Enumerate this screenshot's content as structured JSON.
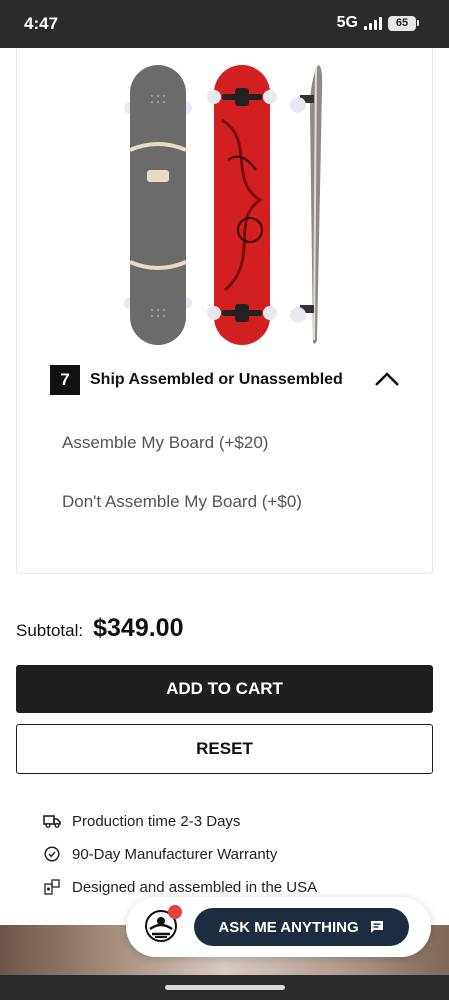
{
  "status_bar": {
    "time": "4:47",
    "network": "5G",
    "battery": "65"
  },
  "product": {
    "image_alt": "Three longboard views: grey deck top, red graphic underside, side profile"
  },
  "step": {
    "number": "7",
    "title": "Ship Assembled or Unassembled",
    "expanded": true
  },
  "options": [
    {
      "label": "Assemble My Board (+$20)"
    },
    {
      "label": "Don't Assemble My Board (+$0)"
    }
  ],
  "subtotal": {
    "label": "Subtotal:",
    "value": "$349.00"
  },
  "buttons": {
    "add_to_cart": "ADD TO CART",
    "reset": "RESET"
  },
  "features": [
    {
      "icon": "truck-icon",
      "text": "Production time 2-3 Days"
    },
    {
      "icon": "badge-check-icon",
      "text": "90-Day Manufacturer Warranty"
    },
    {
      "icon": "puzzle-icon",
      "text": "Designed and assembled in the USA"
    }
  ],
  "chat": {
    "label": "ASK ME ANYTHING",
    "icon": "chat-icon"
  },
  "colors": {
    "primary": "#1f1f1f",
    "chat_button": "#1d2d3f",
    "notification": "#e8413c",
    "deck_red": "#d21f1f",
    "deck_grey": "#6e6e6e"
  }
}
